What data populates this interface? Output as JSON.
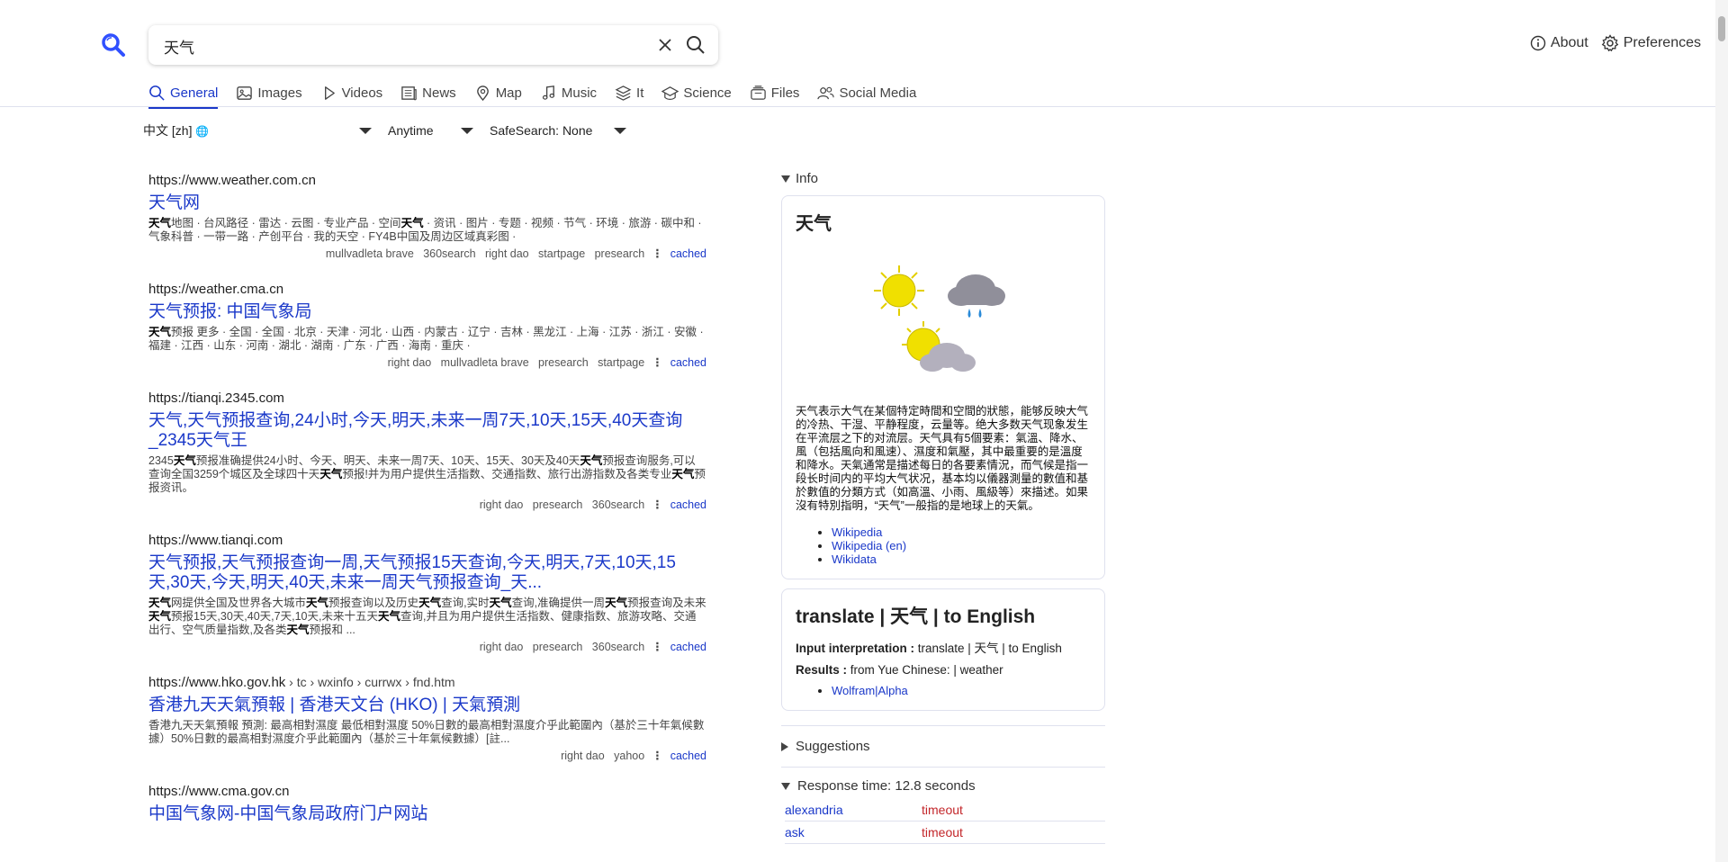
{
  "search": {
    "query": "天气"
  },
  "top_links": {
    "about": "About",
    "preferences": "Preferences"
  },
  "tabs": [
    {
      "label": "General",
      "icon": "search-icon",
      "active": true
    },
    {
      "label": "Images",
      "icon": "image-icon"
    },
    {
      "label": "Videos",
      "icon": "play-icon"
    },
    {
      "label": "News",
      "icon": "newspaper-icon"
    },
    {
      "label": "Map",
      "icon": "map-pin-icon"
    },
    {
      "label": "Music",
      "icon": "music-icon"
    },
    {
      "label": "It",
      "icon": "layers-icon"
    },
    {
      "label": "Science",
      "icon": "school-icon"
    },
    {
      "label": "Files",
      "icon": "files-icon"
    },
    {
      "label": "Social Media",
      "icon": "people-icon"
    }
  ],
  "filters": {
    "language": "中文 [zh]",
    "time": "Anytime",
    "safesearch": "SafeSearch: None"
  },
  "results": [
    {
      "url": "https://www.weather.com.cn",
      "crumbs": "",
      "title": "天气网",
      "snippet_html": "<b>天气</b>地图 · 台风路径 · 雷达 · 云图 · 专业产品 · 空间<b>天气</b> · 资讯 · 图片 · 专题 · 视频 · 节气 · 环境 · 旅游 · 碳中和 · 气象科普 · 一带一路 · 产创平台 · 我的天空 · FY4B中国及周边区域真彩图 ·",
      "engines": "mullvadleta brave   360search   right dao   startpage   presearch",
      "cached": "cached"
    },
    {
      "url": "https://weather.cma.cn",
      "crumbs": "",
      "title": "天气预报: 中国气象局",
      "snippet_html": "<b>天气</b>预报 更多 · 全国 · 全国 · 北京 · 天津 · 河北 · 山西 · 内蒙古 · 辽宁 · 吉林 · 黑龙江 · 上海 · 江苏 · 浙江 · 安徽 · 福建 · 江西 · 山东 · 河南 · 湖北 · 湖南 · 广东 · 广西 · 海南 · 重庆 ·",
      "engines": "right dao   mullvadleta brave   presearch   startpage",
      "cached": "cached"
    },
    {
      "url": "https://tianqi.2345.com",
      "crumbs": "",
      "title": "天气,天气预报查询,24小时,今天,明天,未来一周7天,10天,15天,40天查询_2345天气王",
      "snippet_html": "2345<b>天气</b>预报准确提供24小时、今天、明天、未来一周7天、10天、15天、30天及40天<b>天气</b>预报查询服务,可以查询全国3259个城区及全球四十天<b>天气</b>预报!并为用户提供生活指数、交通指数、旅行出游指数及各类专业<b>天气</b>预报资讯。",
      "engines": "right dao   presearch   360search",
      "cached": "cached"
    },
    {
      "url": "https://www.tianqi.com",
      "crumbs": "",
      "title": "天气预报,天气预报查询一周,天气预报15天查询,今天,明天,7天,10天,15天,30天,今天,明天,40天,未来一周天气预报查询_天...",
      "snippet_html": "<b>天气</b>网提供全国及世界各大城市<b>天气</b>预报查询以及历史<b>天气</b>查询,实时<b>天气</b>查询,准确提供一周<b>天气</b>预报查询及未来<b>天气</b>预报15天,30天,40天,7天,10天,未来十五天<b>天气</b>查询,并且为用户提供生活指数、健康指数、旅游攻略、交通出行、空气质量指数,及各类<b>天气</b>预报和 ...",
      "engines": "right dao   presearch   360search",
      "cached": "cached"
    },
    {
      "url": "https://www.hko.gov.hk",
      "crumbs": " › tc › wxinfo › currwx › fnd.htm",
      "title": "香港九天天氣預報 | 香港天文台 (HKO) | 天氣預測",
      "snippet_html": "香港九天天氣預報 預測: 最高相對濕度 最低相對濕度 50%日數的最高相對濕度介乎此範圍內（基於三十年氣候數據）50%日數的最高相對濕度介乎此範圍內（基於三十年氣候數據）[註...",
      "engines": "right dao   yahoo",
      "cached": "cached"
    },
    {
      "url": "https://www.cma.gov.cn",
      "crumbs": "",
      "title": "中国气象网-中国气象局政府门户网站",
      "snippet_html": "",
      "engines": "",
      "cached": ""
    }
  ],
  "sidebar": {
    "info_heading": "Info",
    "infobox": {
      "title": "天气",
      "description": "天气表示大气在某個特定時間和空間的狀態，能够反映大气的冷热、干湿、平静程度，云量等。绝大多数天气现象发生在平流层之下的对流层。天气具有5個要素：氣溫、降水、風（包括風向和風速）、濕度和氣壓，其中最重要的是溫度和降水。天氣通常是描述每日的各要素情況，而气候是指一段长时间内的平均大气状况，基本均以儀器測量的數值和基於數值的分類方式（如高溫、小雨、風級等）來描述。如果沒有特別指明，“天气”一般指的是地球上的天氣。",
      "links": [
        "Wikipedia",
        "Wikipedia (en)",
        "Wikidata"
      ]
    },
    "answer": {
      "title": "translate | 天气 | to English",
      "input_label": "Input interpretation :",
      "input_value": " translate | 天气 | to English",
      "results_label": "Results :",
      "results_value": " from Yue Chinese: | weather",
      "source": "Wolfram|Alpha"
    },
    "suggestions_heading": "Suggestions",
    "response_heading": "Response time: 12.8 seconds",
    "engine_errors": [
      {
        "engine": "alexandria",
        "error": "timeout"
      },
      {
        "engine": "ask",
        "error": "timeout"
      }
    ]
  },
  "colors": {
    "link": "#1a38c9",
    "error": "#c3262a",
    "accent": "#1a38c9"
  }
}
